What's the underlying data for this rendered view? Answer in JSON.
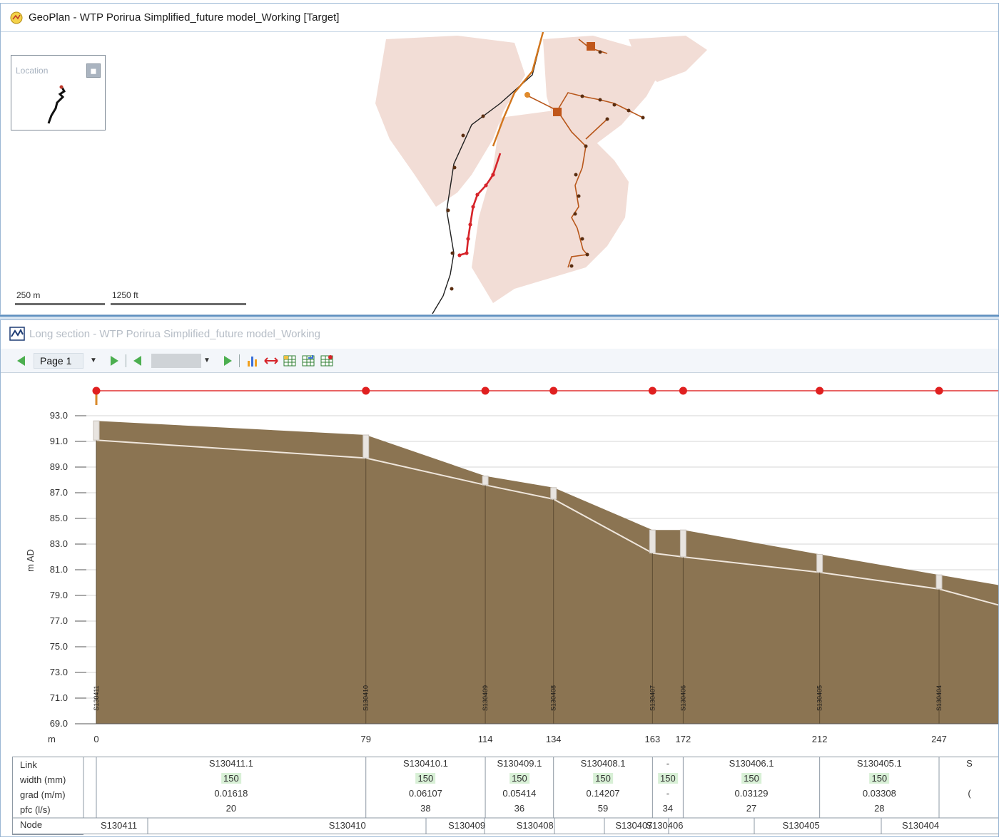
{
  "geoplan": {
    "title": "GeoPlan - WTP Porirua Simplified_future model_Working [Target]",
    "overview_title": "Location",
    "scale_m": "250 m",
    "scale_ft": "1250 ft"
  },
  "long_section": {
    "title": "Long section - WTP Porirua Simplified_future model_Working",
    "toolbar": {
      "page_label": "Page 1"
    },
    "y_axis_label": "m AD",
    "x_axis_unit": "m"
  },
  "chart_data": {
    "type": "area",
    "ylabel": "m AD",
    "xlabel": "m",
    "ylim": [
      69.0,
      93.0
    ],
    "y_ticks": [
      "93.0",
      "91.0",
      "89.0",
      "87.0",
      "85.0",
      "83.0",
      "81.0",
      "79.0",
      "77.0",
      "75.0",
      "73.0",
      "71.0",
      "69.0"
    ],
    "chainage": [
      0,
      79,
      114,
      134,
      163,
      172,
      212,
      247
    ],
    "chainage_labels": [
      "0",
      "79",
      "114",
      "134",
      "163",
      "172",
      "212",
      "247"
    ],
    "ground_level": [
      92.6,
      91.5,
      88.3,
      87.4,
      84.1,
      84.1,
      82.2,
      80.6
    ],
    "invert_level": [
      91.1,
      89.7,
      87.6,
      86.5,
      82.3,
      82.0,
      80.8,
      79.5
    ],
    "nodes": [
      "S130411",
      "S130410",
      "S130409",
      "S130408",
      "S130407",
      "S130406",
      "S130405",
      "S130404"
    ]
  },
  "table": {
    "row_labels": [
      "Link",
      "width (mm)",
      "grad (m/m)",
      "pfc (l/s)",
      "Node"
    ],
    "links": [
      {
        "id": "S130411.1",
        "width": "150",
        "grad": "0.01618",
        "pfc": "20"
      },
      {
        "id": "S130410.1",
        "width": "150",
        "grad": "0.06107",
        "pfc": "38"
      },
      {
        "id": "S130409.1",
        "width": "150",
        "grad": "0.05414",
        "pfc": "36"
      },
      {
        "id": "S130408.1",
        "width": "150",
        "grad": "0.14207",
        "pfc": "59"
      },
      {
        "id": "-",
        "width": "150",
        "grad": "-",
        "pfc": "34"
      },
      {
        "id": "S130406.1",
        "width": "150",
        "grad": "0.03129",
        "pfc": "27"
      },
      {
        "id": "S130405.1",
        "width": "150",
        "grad": "0.03308",
        "pfc": "28"
      },
      {
        "id": "S",
        "width": "",
        "grad": "(",
        "pfc": ""
      }
    ],
    "nodes": [
      "S130411",
      "S130410",
      "S130409",
      "S130408",
      "S130407",
      "S130406",
      "S130405",
      "S130404"
    ]
  }
}
